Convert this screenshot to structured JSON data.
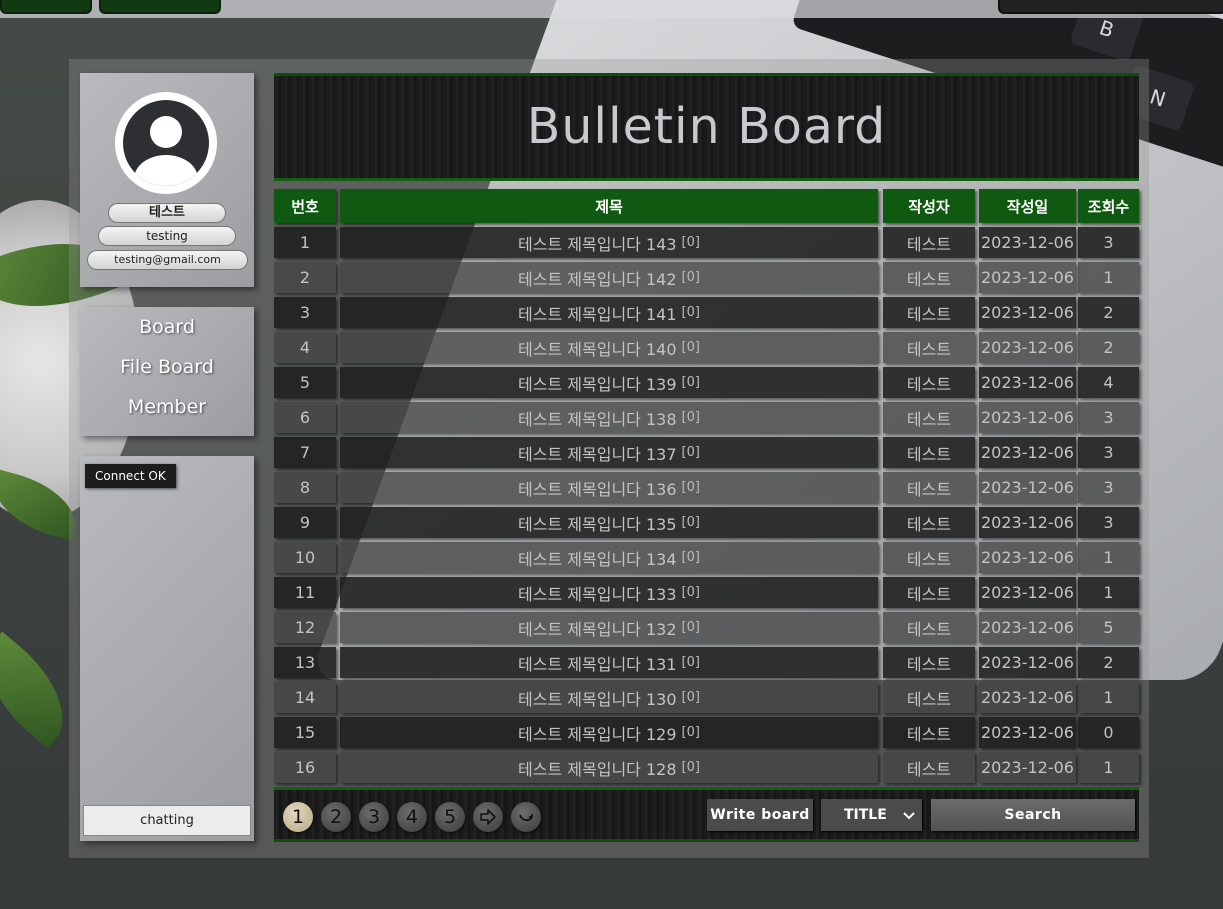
{
  "board": {
    "title": "Bulletin Board",
    "columns": [
      "번호",
      "제목",
      "작성자",
      "작성일",
      "조회수"
    ],
    "rows": [
      {
        "no": "1",
        "title": "테스트 제목입니다 143",
        "comments": "[0]",
        "author": "테스트",
        "date": "2023-12-06",
        "views": "3"
      },
      {
        "no": "2",
        "title": "테스트 제목입니다 142",
        "comments": "[0]",
        "author": "테스트",
        "date": "2023-12-06",
        "views": "1"
      },
      {
        "no": "3",
        "title": "테스트 제목입니다 141",
        "comments": "[0]",
        "author": "테스트",
        "date": "2023-12-06",
        "views": "2"
      },
      {
        "no": "4",
        "title": "테스트 제목입니다 140",
        "comments": "[0]",
        "author": "테스트",
        "date": "2023-12-06",
        "views": "2"
      },
      {
        "no": "5",
        "title": "테스트 제목입니다 139",
        "comments": "[0]",
        "author": "테스트",
        "date": "2023-12-06",
        "views": "4"
      },
      {
        "no": "6",
        "title": "테스트 제목입니다 138",
        "comments": "[0]",
        "author": "테스트",
        "date": "2023-12-06",
        "views": "3"
      },
      {
        "no": "7",
        "title": "테스트 제목입니다 137",
        "comments": "[0]",
        "author": "테스트",
        "date": "2023-12-06",
        "views": "3"
      },
      {
        "no": "8",
        "title": "테스트 제목입니다 136",
        "comments": "[0]",
        "author": "테스트",
        "date": "2023-12-06",
        "views": "3"
      },
      {
        "no": "9",
        "title": "테스트 제목입니다 135",
        "comments": "[0]",
        "author": "테스트",
        "date": "2023-12-06",
        "views": "3"
      },
      {
        "no": "10",
        "title": "테스트 제목입니다 134",
        "comments": "[0]",
        "author": "테스트",
        "date": "2023-12-06",
        "views": "1"
      },
      {
        "no": "11",
        "title": "테스트 제목입니다 133",
        "comments": "[0]",
        "author": "테스트",
        "date": "2023-12-06",
        "views": "1"
      },
      {
        "no": "12",
        "title": "테스트 제목입니다 132",
        "comments": "[0]",
        "author": "테스트",
        "date": "2023-12-06",
        "views": "5"
      },
      {
        "no": "13",
        "title": "테스트 제목입니다 131",
        "comments": "[0]",
        "author": "테스트",
        "date": "2023-12-06",
        "views": "2"
      },
      {
        "no": "14",
        "title": "테스트 제목입니다 130",
        "comments": "[0]",
        "author": "테스트",
        "date": "2023-12-06",
        "views": "1"
      },
      {
        "no": "15",
        "title": "테스트 제목입니다 129",
        "comments": "[0]",
        "author": "테스트",
        "date": "2023-12-06",
        "views": "0"
      },
      {
        "no": "16",
        "title": "테스트 제목입니다 128",
        "comments": "[0]",
        "author": "테스트",
        "date": "2023-12-06",
        "views": "1"
      }
    ]
  },
  "profile": {
    "name": "테스트",
    "id": "testing",
    "email": "testing@gmail.com"
  },
  "nav": {
    "items": [
      "Board",
      "File Board",
      "Member"
    ]
  },
  "chat": {
    "status": "Connect OK",
    "button": "chatting"
  },
  "footer": {
    "pages": [
      "1",
      "2",
      "3",
      "4",
      "5"
    ],
    "active_page": "1",
    "next_icon": "arrow-right-icon",
    "last_icon": "curved-arrow-icon",
    "write_label": "Write board",
    "search_type": "TITLE",
    "search_label": "Search"
  },
  "background": {
    "keys": [
      "B",
      "N"
    ]
  },
  "colors": {
    "accent_green": "#0f5a10",
    "board_dark": "#1a1a1a",
    "sidebar": "#a9abaf",
    "active_page": "#c8bb9a"
  }
}
